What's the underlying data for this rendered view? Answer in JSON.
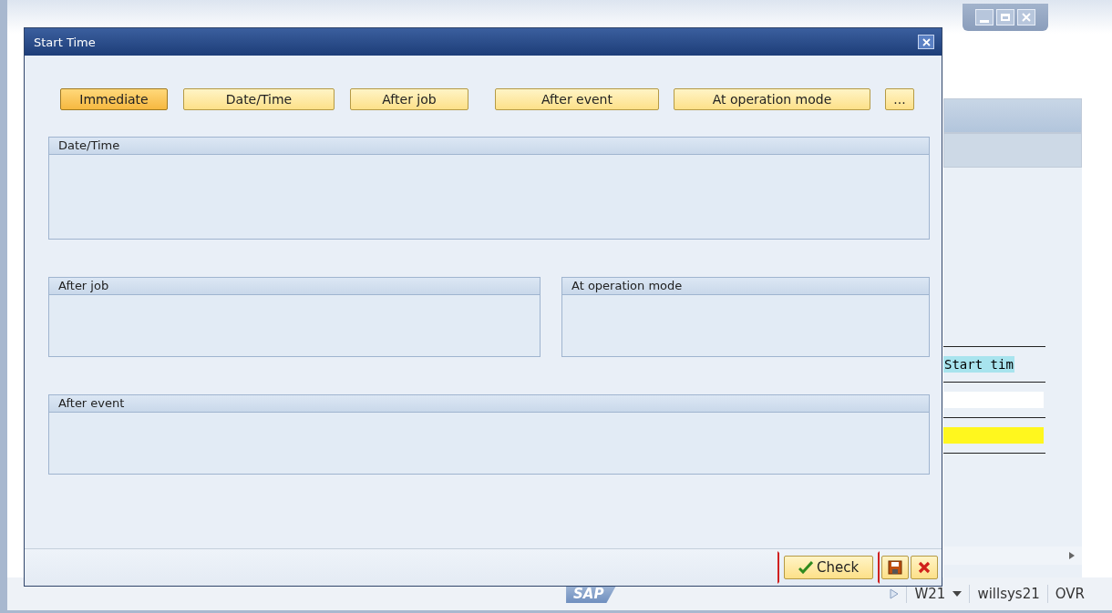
{
  "dialog": {
    "title": "Start Time",
    "buttons": [
      {
        "label": "Immediate",
        "selected": true
      },
      {
        "label": "Date/Time",
        "selected": false
      },
      {
        "label": "After job",
        "selected": false
      },
      {
        "label": "After event",
        "selected": false
      },
      {
        "label": "At operation mode",
        "selected": false
      },
      {
        "label": "...",
        "selected": false
      }
    ],
    "groups": [
      {
        "title": "Date/Time"
      },
      {
        "title": "After job"
      },
      {
        "title": "At operation mode"
      },
      {
        "title": "After event"
      }
    ],
    "footer": {
      "check": {
        "label": "Check",
        "focused": true
      }
    }
  },
  "background": {
    "table_header": "Start tim",
    "logo": "SAP",
    "status_bar": {
      "session": "W21",
      "server": "willsys21",
      "mode": "OVR"
    }
  }
}
